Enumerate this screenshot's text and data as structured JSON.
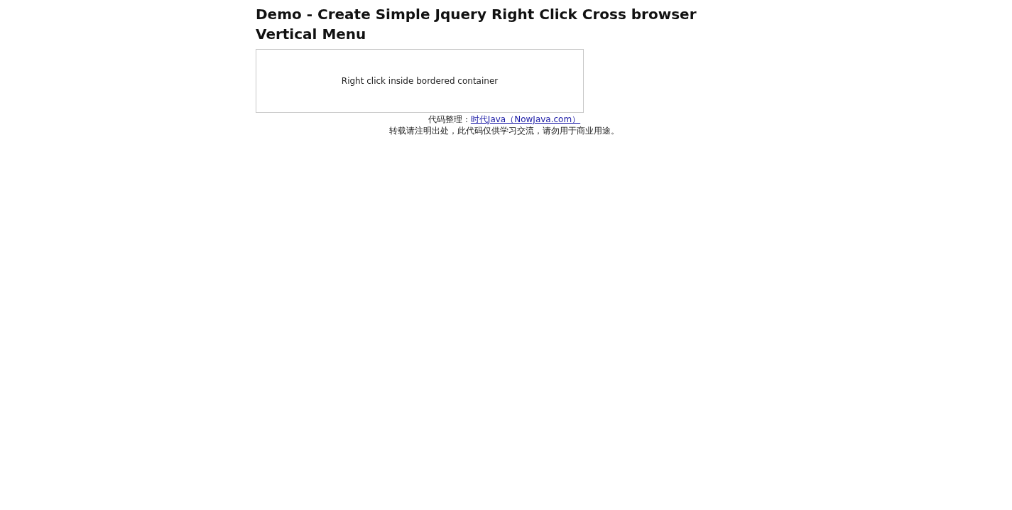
{
  "page": {
    "title": "Demo - Create Simple Jquery Right Click Cross browser Vertical Menu",
    "container": {
      "text": "Right click inside bordered container"
    }
  },
  "footer": {
    "credit_label": "代码整理：",
    "credit_link": "时代Java（NowJava.com）",
    "notice": "转载请注明出处，此代码仅供学习交流，请勿用于商业用途。"
  }
}
